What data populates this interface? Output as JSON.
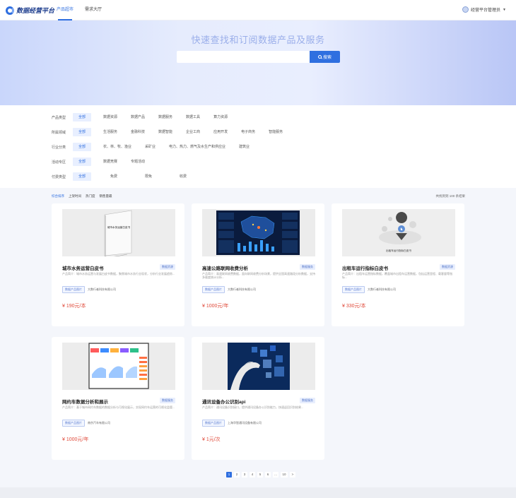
{
  "header": {
    "logo_text": "数据经营平台",
    "nav": [
      {
        "label": "产品超市",
        "active": true
      },
      {
        "label": "需求大厅",
        "active": false
      }
    ],
    "user_label": "经营平台管理员"
  },
  "hero": {
    "title": "快速查找和订阅数据产品及服务",
    "search_placeholder": "",
    "search_button": "搜索"
  },
  "filters": [
    {
      "label": "产品类型",
      "options": [
        "全部",
        "数据资源",
        "数据产品",
        "数据服务",
        "数据工具",
        "算力资源"
      ],
      "selected": 0
    },
    {
      "label": "所属领域",
      "options": [
        "全部",
        "生活服务",
        "金融科技",
        "数据智能",
        "企业工商",
        "应用开发",
        "电子商务",
        "智能服务"
      ],
      "selected": 0
    },
    {
      "label": "行业分类",
      "options": [
        "全部",
        "农、林、牧、渔业",
        "采矿业",
        "电力、热力、燃气及水生产和供应业",
        "建筑业"
      ],
      "selected": 0
    },
    {
      "label": "活动专区",
      "options": [
        "全部",
        "数据竞赛",
        "专题活动"
      ],
      "selected": 0
    },
    {
      "label": "付费类型",
      "options": [
        "全部",
        "免费",
        "限免",
        "收费"
      ],
      "selected": 0
    }
  ],
  "sort": {
    "items": [
      "综合排序",
      "上架时间",
      "热门度",
      "销售量最"
    ],
    "active": 0,
    "result_text": "共找到到 100 条结果"
  },
  "products": [
    {
      "title": "城市水务运营白皮书",
      "tag": "数据资源",
      "desc": "产品简介：城市水务运营与发展白皮书数据，聚焦城市水务行业现状，分析行业发展趋势...",
      "badge": "数据产品图片",
      "company": "大数行者科技有限公司",
      "price": "¥ 190元/本",
      "image_caption": "城市水务运营白皮书"
    },
    {
      "title": "高速公路联网收费分析",
      "tag": "数据服务",
      "desc": "产品简介：高速联网收费数据，面向联网收费分析场景，提供全国高速路段分析数据，支持多维度统计分析...",
      "badge": "数据产品图片",
      "company": "大数行者科技有限公司",
      "price": "¥ 1000元/年",
      "image_caption": ""
    },
    {
      "title": "出租车运行指标白皮书",
      "tag": "数据资源",
      "desc": "产品简介：出租车运营指标数据，覆盖城市出租车运营数据，包括运营里程、载客量等指标...",
      "badge": "数据产品图片",
      "company": "大数行者科技有限公司",
      "price": "¥ 330元/本",
      "image_caption": "出租车运行指标白皮书"
    },
    {
      "title": "网约车数据分析和展示",
      "tag": "数据服务",
      "desc": "产品简介：基于城市网约车数据的数据分析与可视化展示，实现网约车运营的可视化监管...",
      "badge": "数据产品图片",
      "company": "南京汽车有限公司",
      "price": "¥ 1000元/年",
      "image_caption": ""
    },
    {
      "title": "通讯设备办公识别api",
      "tag": "数据服务",
      "desc": "产品简介：通讯设备识别接口，提供通讯设备办公识别能力，快速返回识别结果...",
      "badge": "数据产品图片",
      "company": "上海华智通讯设备有限公司",
      "price": "¥ 1元/次",
      "image_caption": ""
    }
  ],
  "pagination": {
    "pages": [
      "1",
      "2",
      "3",
      "4",
      "5",
      "6",
      "...",
      "10",
      ">"
    ],
    "active": 0
  }
}
